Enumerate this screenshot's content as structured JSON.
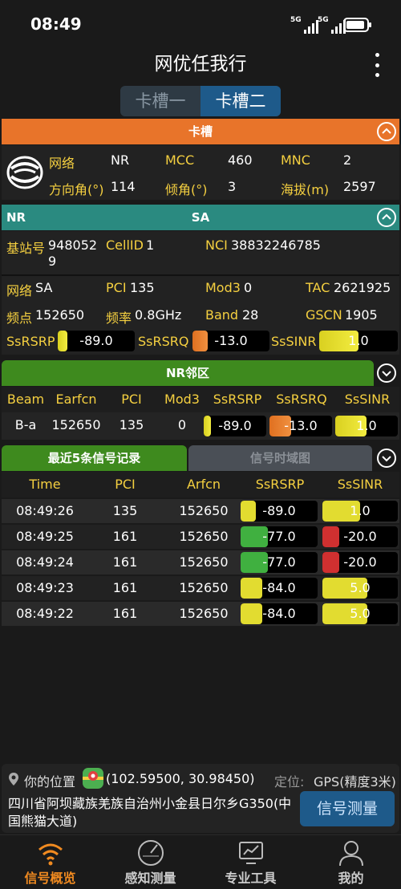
{
  "status": {
    "time": "08:49",
    "net1": "5G",
    "net2": "5G"
  },
  "app": {
    "title": "网优任我行"
  },
  "sim_tabs": [
    {
      "label": "卡槽一"
    },
    {
      "label": "卡槽二"
    }
  ],
  "slot": {
    "header": "卡槽",
    "rows": [
      [
        {
          "k": "网络",
          "v": "NR"
        },
        {
          "k": "MCC",
          "v": "460"
        },
        {
          "k": "MNC",
          "v": "2"
        }
      ],
      [
        {
          "k": "方向角(°)",
          "v": "114"
        },
        {
          "k": "倾角(°)",
          "v": "3"
        },
        {
          "k": "海拔(m)",
          "v": "2597"
        }
      ]
    ]
  },
  "nr": {
    "header_left": "NR",
    "header_center": "SA",
    "gnb_label": "基站号",
    "gnb_value_line1": "948052",
    "gnb_value_line2": "9",
    "cellid_label": "CellID",
    "cellid_value": "1",
    "nci_label": "NCI",
    "nci_value": "38832246785",
    "net_label": "网络",
    "net_value": "SA",
    "pci_label": "PCI",
    "pci_value": "135",
    "mod3_label": "Mod3",
    "mod3_value": "0",
    "tac_label": "TAC",
    "tac_value": "2621925",
    "freqpt_label": "频点",
    "freqpt_value": "152650",
    "freq_label": "频率",
    "freq_value": "0.8GHz",
    "band_label": "Band",
    "band_value": "28",
    "gscn_label": "GSCN",
    "gscn_value": "1905",
    "rsrp_label": "SsRSRP",
    "rsrp_value": "-89.0",
    "rsrp_level": 0.12,
    "rsrq_label": "SsRSRQ",
    "rsrq_value": "-13.0",
    "rsrq_level": 0.2,
    "sinr_label": "SsSINR",
    "sinr_value": "1.0",
    "sinr_level": 0.5
  },
  "neighbor": {
    "header": "NR邻区",
    "cols": [
      "Beam",
      "Earfcn",
      "PCI",
      "Mod3",
      "SsRSRP",
      "SsRSRQ",
      "SsSINR"
    ],
    "row": {
      "beam": "B-a",
      "earfcn": "152650",
      "pci": "135",
      "mod3": "0",
      "rsrp": "-89.0",
      "rsrp_level": 0.12,
      "rsrq": "-13.0",
      "rsrq_level": 0.35,
      "sinr": "1.0",
      "sinr_level": 0.5
    }
  },
  "records": {
    "tab_active": "最近5条信号记录",
    "tab_inactive": "信号时域图",
    "cols": [
      "Time",
      "PCI",
      "Arfcn",
      "SsRSRP",
      "SsSINR"
    ],
    "rows": [
      {
        "time": "08:49:26",
        "pci": "135",
        "arfcn": "152650",
        "rsrp": "-89.0",
        "rsrp_level": 0.2,
        "rsrp_color": "#e2dc30",
        "sinr": "1.0",
        "sinr_level": 0.5,
        "sinr_color": "#e2dc30"
      },
      {
        "time": "08:49:25",
        "pci": "161",
        "arfcn": "152650",
        "rsrp": "-77.0",
        "rsrp_level": 0.35,
        "rsrp_color": "#40b040",
        "sinr": "-20.0",
        "sinr_level": 0.22,
        "sinr_color": "#d03030"
      },
      {
        "time": "08:49:24",
        "pci": "161",
        "arfcn": "152650",
        "rsrp": "-77.0",
        "rsrp_level": 0.35,
        "rsrp_color": "#40b040",
        "sinr": "-20.0",
        "sinr_level": 0.22,
        "sinr_color": "#d03030"
      },
      {
        "time": "08:49:23",
        "pci": "161",
        "arfcn": "152650",
        "rsrp": "-84.0",
        "rsrp_level": 0.28,
        "rsrp_color": "#e2dc30",
        "sinr": "5.0",
        "sinr_level": 0.6,
        "sinr_color": "#e2dc30"
      },
      {
        "time": "08:49:22",
        "pci": "161",
        "arfcn": "152650",
        "rsrp": "-84.0",
        "rsrp_level": 0.28,
        "rsrp_color": "#e2dc30",
        "sinr": "5.0",
        "sinr_level": 0.6,
        "sinr_color": "#e2dc30"
      }
    ]
  },
  "location": {
    "label": "你的位置",
    "coords": "(102.59500, 30.98450)",
    "gps_label": "定位:",
    "gps_value": "GPS(精度3米)",
    "address_line1": "四川省阿坝藏族羌族自治州小金县日尔乡G350(中",
    "address_line2": "国熊猫大道)",
    "button": "信号测量"
  },
  "nav": [
    {
      "label": "信号概览",
      "icon": "wifi-icon"
    },
    {
      "label": "感知测量",
      "icon": "gauge-icon"
    },
    {
      "label": "专业工具",
      "icon": "monitor-chart-icon"
    },
    {
      "label": "我的",
      "icon": "user-icon"
    }
  ],
  "colors": {
    "orange": "#e8742a",
    "teal": "#2a8a80",
    "green": "#3e8a1e",
    "blue": "#1e5a8a"
  }
}
